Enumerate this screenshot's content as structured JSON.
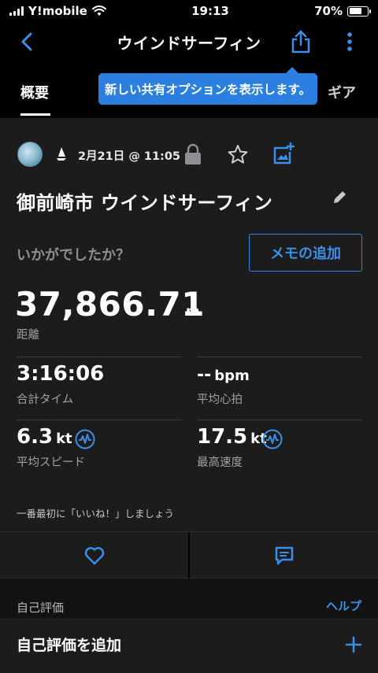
{
  "status_bar": {
    "carrier": "Y!mobile",
    "time": "19:13",
    "battery_percent": "70%",
    "battery_level": 0.7
  },
  "nav": {
    "title": "ウインドサーフィン",
    "back_icon": "chevron-left-icon",
    "share_icon": "share-icon",
    "more_icon": "vertical-ellipsis-icon"
  },
  "tabs": {
    "overview": "概要",
    "gear": "ギア"
  },
  "tooltip": {
    "text": "新しい共有オプションを表示します。"
  },
  "activity": {
    "date_time": "2月21日 @ 11:05",
    "title": "御前崎市 ウインドサーフィン",
    "feel_prompt": "いかがでしたか？",
    "memo_button": "メモの追加"
  },
  "stats": {
    "distance": {
      "value": "37,866.71",
      "unit": "m",
      "label": "距離"
    },
    "total_time": {
      "value": "3:16:06",
      "label": "合計タイム"
    },
    "avg_hr": {
      "value": "--",
      "unit": "bpm",
      "label": "平均心拍"
    },
    "avg_speed": {
      "value": "6.3",
      "unit": "kt",
      "label": "平均スピード"
    },
    "max_speed": {
      "value": "17.5",
      "unit": "kt",
      "label": "最高速度"
    }
  },
  "social": {
    "like_prompt": "一番最初に「いいね！」しましょう"
  },
  "self_eval": {
    "title": "自己評価",
    "help": "ヘルプ",
    "add_label": "自己評価を追加"
  },
  "colors": {
    "accent": "#2f85e4",
    "tooltip_bg": "#2b7fe0",
    "card_bg": "#1c1c1d",
    "page_bg": "#000000",
    "muted_text": "#a0a0a5"
  }
}
